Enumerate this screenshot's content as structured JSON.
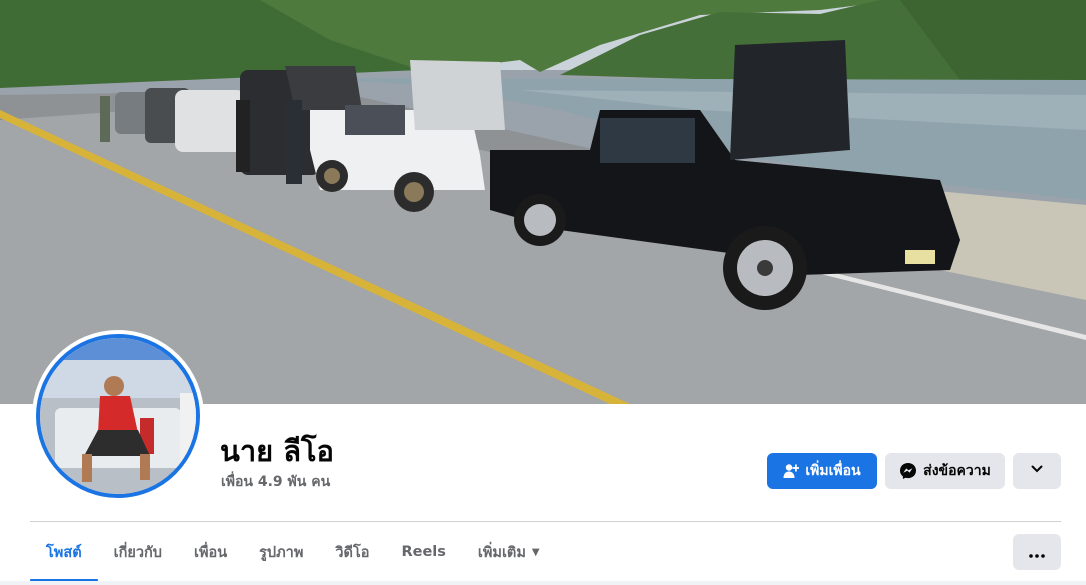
{
  "profile": {
    "name": "นาย ลีโอ",
    "friends_text": "เพื่อน 4.9 พัน คน"
  },
  "actions": {
    "add_friend_label": "เพิ่มเพื่อน",
    "message_label": "ส่งข้อความ"
  },
  "tabs": [
    {
      "label": "โพสต์",
      "active": true
    },
    {
      "label": "เกี่ยวกับ",
      "active": false
    },
    {
      "label": "เพื่อน",
      "active": false
    },
    {
      "label": "รูปภาพ",
      "active": false
    },
    {
      "label": "วิดีโอ",
      "active": false
    },
    {
      "label": "Reels",
      "active": false
    },
    {
      "label": "เพิ่มเติม",
      "active": false
    }
  ],
  "colors": {
    "accent": "#1b74e4",
    "secondary_button": "#e4e6eb",
    "muted_text": "#65676b"
  },
  "icons": {
    "add_friend": "person-plus-icon",
    "message": "messenger-icon",
    "dropdown": "chevron-down-icon",
    "more": "ellipsis-icon",
    "tab_more_caret": "caret-down-icon"
  }
}
